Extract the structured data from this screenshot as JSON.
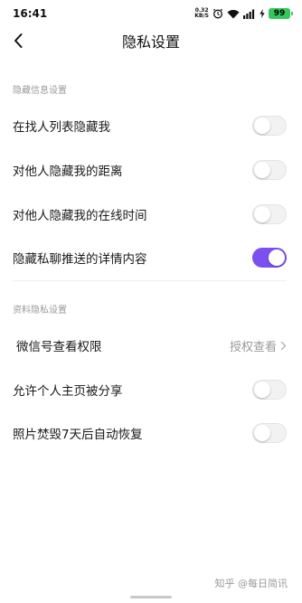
{
  "status_bar": {
    "time": "16:41",
    "net_speed_value": "0.32",
    "net_speed_unit": "KB/S",
    "battery": "99"
  },
  "nav": {
    "title": "隐私设置"
  },
  "sections": [
    {
      "header": "隐藏信息设置",
      "items": [
        {
          "label": "在找人列表隐藏我",
          "toggle_on": false
        },
        {
          "label": "对他人隐藏我的距离",
          "toggle_on": false
        },
        {
          "label": "对他人隐藏我的在线时间",
          "toggle_on": false
        },
        {
          "label": "隐藏私聊推送的详情内容",
          "toggle_on": true
        }
      ]
    },
    {
      "header": "资料隐私设置",
      "items": [
        {
          "label": "微信号查看权限",
          "value": "授权查看"
        },
        {
          "label": "允许个人主页被分享",
          "toggle_on": false
        },
        {
          "label": "照片焚毁7天后自动恢复",
          "toggle_on": false
        }
      ]
    }
  ],
  "watermark": "知乎 @每日简讯",
  "colors": {
    "accent": "#7b4ff0",
    "battery": "#34c759"
  }
}
